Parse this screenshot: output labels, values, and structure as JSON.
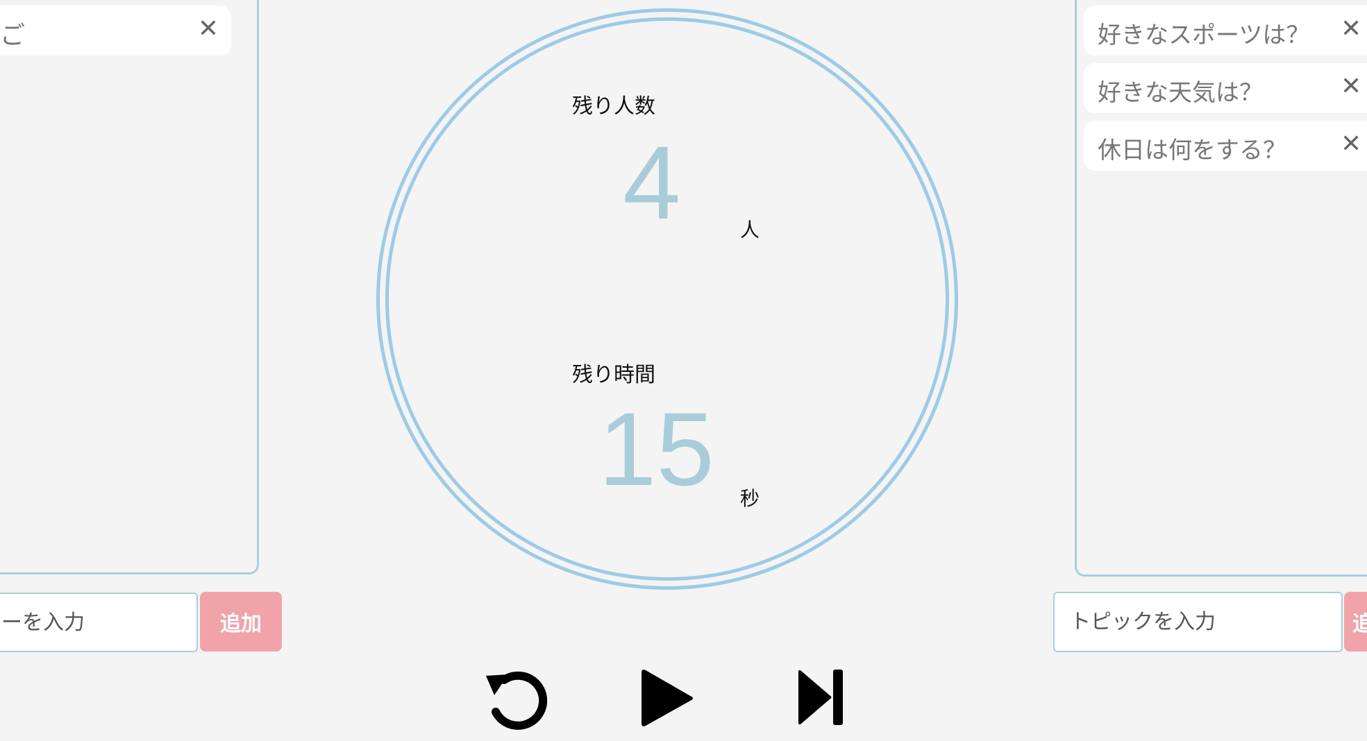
{
  "members": {
    "items": [
      {
        "label": "ご"
      }
    ],
    "input_placeholder": "ーを入力",
    "add_label": "追加"
  },
  "topics": {
    "items": [
      {
        "label": "好きなスポーツは？"
      },
      {
        "label": "好きな天気は？"
      },
      {
        "label": "休日は何をする？"
      }
    ],
    "input_placeholder": "トピックを入力",
    "add_label": "追"
  },
  "timer": {
    "remaining_people_label": "残り人数",
    "remaining_people": "4",
    "people_unit": "人",
    "remaining_time_label": "残り時間",
    "remaining_time": "15",
    "time_unit": "秒"
  },
  "icons": {
    "remove": "close-icon",
    "reset": "reset-icon",
    "play": "play-icon",
    "skip": "skip-next-icon"
  },
  "colors": {
    "ring": "#9ecbe6",
    "number": "#a9cdd8",
    "add_button": "#f0a4aa",
    "panel_border": "#a8cfdc"
  }
}
